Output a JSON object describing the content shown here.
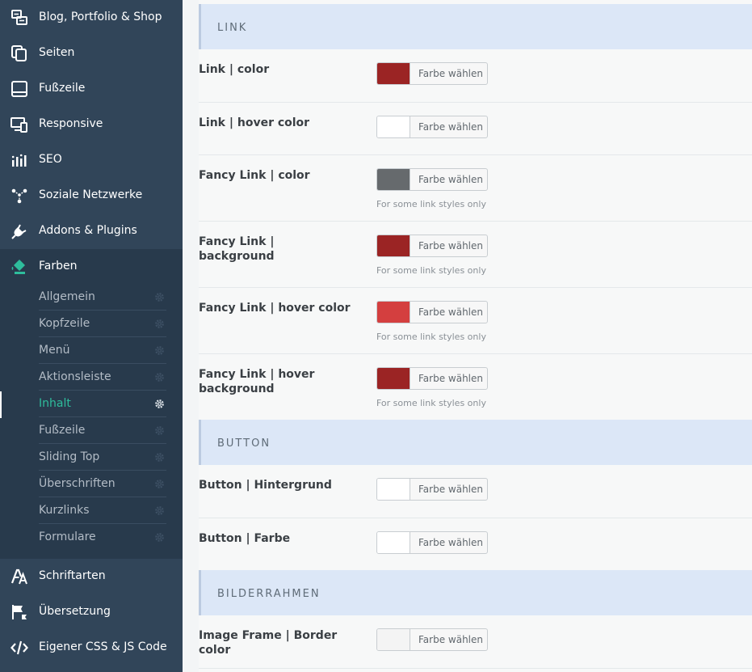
{
  "sidebar": {
    "top_items": [
      {
        "label": "Blog, Portfolio & Shop",
        "icon": "blog-icon"
      },
      {
        "label": "Seiten",
        "icon": "pages-icon"
      },
      {
        "label": "Fußzeile",
        "icon": "footer-icon"
      },
      {
        "label": "Responsive",
        "icon": "responsive-icon"
      },
      {
        "label": "SEO",
        "icon": "seo-icon"
      },
      {
        "label": "Soziale Netzwerke",
        "icon": "social-icon"
      },
      {
        "label": "Addons & Plugins",
        "icon": "plug-icon"
      },
      {
        "label": "Farben",
        "icon": "paint-bucket-icon"
      }
    ],
    "sub_items": [
      {
        "label": "Allgemein"
      },
      {
        "label": "Kopfzeile"
      },
      {
        "label": "Menü"
      },
      {
        "label": "Aktionsleiste"
      },
      {
        "label": "Inhalt",
        "active": true
      },
      {
        "label": "Fußzeile"
      },
      {
        "label": "Sliding Top"
      },
      {
        "label": "Überschriften"
      },
      {
        "label": "Kurzlinks"
      },
      {
        "label": "Formulare"
      }
    ],
    "bottom_items": [
      {
        "label": "Schriftarten",
        "icon": "font-icon"
      },
      {
        "label": "Übersetzung",
        "icon": "flag-icon"
      },
      {
        "label": "Eigener CSS & JS Code",
        "icon": "code-icon"
      }
    ],
    "colors": {
      "accent": "#2ebd9c",
      "background": "#314559"
    }
  },
  "sections": {
    "link": "LINK",
    "button": "BUTTON",
    "frame": "BILDERRAHMEN"
  },
  "picker_label": "Farbe wählen",
  "fields": [
    {
      "label": "Link | color",
      "color": "#9b2424",
      "hint": ""
    },
    {
      "label": "Link | hover color",
      "color": "#ffffff",
      "hint": ""
    },
    {
      "label": "Fancy Link | color",
      "color": "#666a6d",
      "hint": "For some link styles only"
    },
    {
      "label": "Fancy Link | background",
      "color": "#9b2424",
      "hint": "For some link styles only"
    },
    {
      "label": "Fancy Link | hover color",
      "color": "#d43f3f",
      "hint": "For some link styles only"
    },
    {
      "label": "Fancy Link | hover background",
      "color": "#9b2424",
      "hint": "For some link styles only"
    },
    {
      "label": "Button | Hintergrund",
      "color": "#ffffff",
      "hint": ""
    },
    {
      "label": "Button | Farbe",
      "color": "#ffffff",
      "hint": ""
    },
    {
      "label": "Image Frame | Border color",
      "color": "#f4f4f4",
      "hint": ""
    }
  ]
}
